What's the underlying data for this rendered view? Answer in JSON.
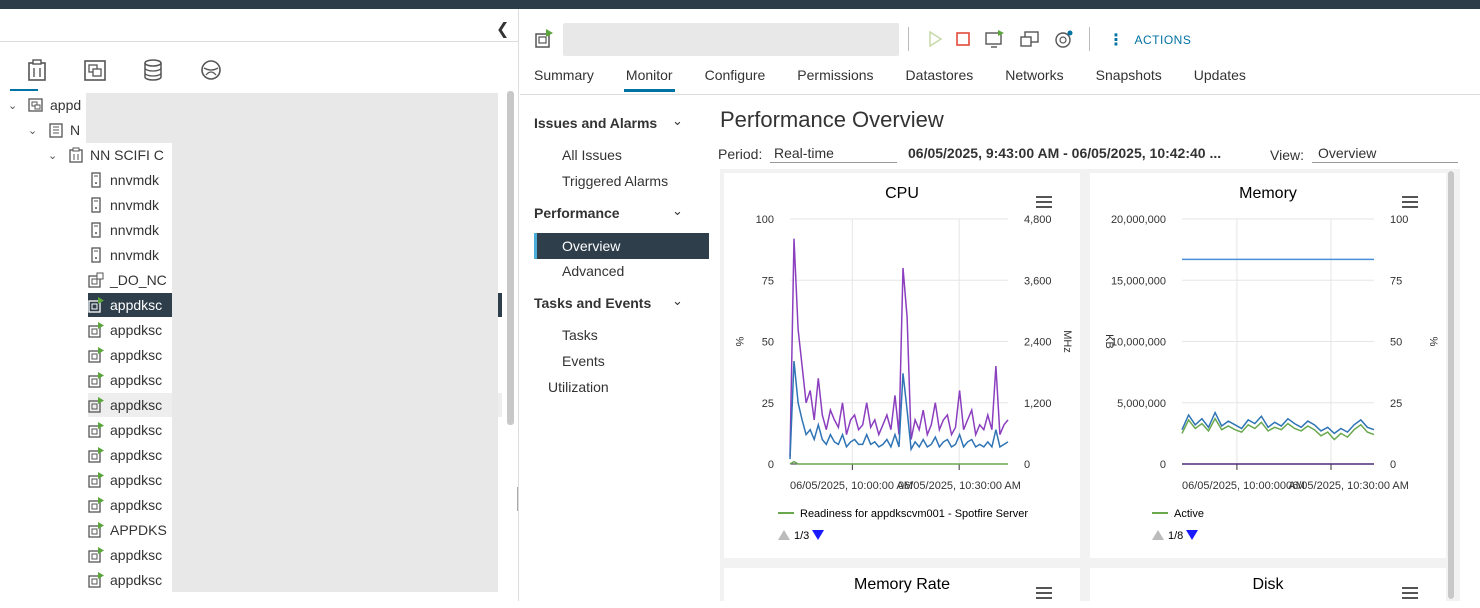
{
  "left_panel": {
    "collapse_icon": "chevron-left-icon",
    "tabs": [
      {
        "name": "hosts-and-clusters",
        "icon": "hosts-clusters-icon",
        "active": true
      },
      {
        "name": "vms-and-templates",
        "icon": "vms-templates-icon",
        "active": false
      },
      {
        "name": "storage",
        "icon": "database-icon",
        "active": false
      },
      {
        "name": "networking",
        "icon": "network-icon",
        "active": false
      }
    ],
    "tree": [
      {
        "label": "appd",
        "level": 0,
        "caret": "▾",
        "icon": "vcenter-icon"
      },
      {
        "label": "N",
        "level": 1,
        "caret": "▾",
        "icon": "datacenter-icon"
      },
      {
        "label": "NN SCIFI C",
        "level": 2,
        "caret": "▾",
        "icon": "cluster-icon"
      },
      {
        "label": "nnvmdk",
        "level": 3,
        "caret": "",
        "icon": "host-icon"
      },
      {
        "label": "nnvmdk",
        "level": 3,
        "caret": "",
        "icon": "host-icon"
      },
      {
        "label": "nnvmdk",
        "level": 3,
        "caret": "",
        "icon": "host-icon"
      },
      {
        "label": "nnvmdk",
        "level": 3,
        "caret": "",
        "icon": "host-icon"
      },
      {
        "label": "_DO_NC",
        "level": 3,
        "caret": "",
        "icon": "vm-off-icon"
      },
      {
        "label": "appdksc",
        "level": 3,
        "caret": "",
        "icon": "vm-on-icon",
        "selected": true
      },
      {
        "label": "appdksc",
        "level": 3,
        "caret": "",
        "icon": "vm-on-icon"
      },
      {
        "label": "appdksc",
        "level": 3,
        "caret": "",
        "icon": "vm-on-icon"
      },
      {
        "label": "appdksc",
        "level": 3,
        "caret": "",
        "icon": "vm-on-icon"
      },
      {
        "label": "appdksc",
        "level": 3,
        "caret": "",
        "icon": "vm-on-icon",
        "hover": true
      },
      {
        "label": "appdksc",
        "level": 3,
        "caret": "",
        "icon": "vm-on-icon"
      },
      {
        "label": "appdksc",
        "level": 3,
        "caret": "",
        "icon": "vm-on-icon"
      },
      {
        "label": "appdksc",
        "level": 3,
        "caret": "",
        "icon": "vm-on-icon"
      },
      {
        "label": "appdksc",
        "level": 3,
        "caret": "",
        "icon": "vm-on-icon"
      },
      {
        "label": "APPDKS",
        "level": 3,
        "caret": "",
        "icon": "vm-on-icon"
      },
      {
        "label": "appdksc",
        "level": 3,
        "caret": "",
        "icon": "vm-on-icon"
      },
      {
        "label": "appdksc",
        "level": 3,
        "caret": "",
        "icon": "vm-on-icon"
      }
    ]
  },
  "toolbar": {
    "object_icon": "vm-on-icon",
    "icons": [
      "power-on-icon",
      "power-off-icon",
      "launch-console-icon",
      "migrate-icon",
      "snapshot-icon"
    ],
    "actions_label": "ACTIONS"
  },
  "tabs": [
    "Summary",
    "Monitor",
    "Configure",
    "Permissions",
    "Datastores",
    "Networks",
    "Snapshots",
    "Updates"
  ],
  "active_tab": "Monitor",
  "nav": {
    "issues_head": "Issues and Alarms",
    "all_issues": "All Issues",
    "triggered_alarms": "Triggered Alarms",
    "performance_head": "Performance",
    "overview": "Overview",
    "advanced": "Advanced",
    "tasks_head": "Tasks and Events",
    "tasks": "Tasks",
    "events": "Events",
    "utilization": "Utilization"
  },
  "content": {
    "title": "Performance Overview",
    "period_label": "Period:",
    "period_value": "Real-time",
    "range": "06/05/2025, 9:43:00 AM - 06/05/2025, 10:42:40 ...",
    "view_label": "View:",
    "view_value": "Overview"
  },
  "chart_data": [
    {
      "type": "line",
      "title": "CPU",
      "ylabel": "%",
      "y2label": "MHz",
      "yticks": [
        "100",
        "75",
        "50",
        "25",
        "0"
      ],
      "y2ticks": [
        "4,800",
        "3,600",
        "2,400",
        "1,200",
        "0"
      ],
      "ylim": [
        0,
        100
      ],
      "xticks": [
        "06/05/2025, 10:00:00 AM",
        "06/05/2025, 10:30:00 AM"
      ],
      "legend": "Readiness for appdkscvm001 - Spotfire Server",
      "legend_page": "1/3",
      "series": [
        {
          "color": "#8b3fbf",
          "values": [
            3,
            92,
            55,
            40,
            25,
            30,
            18,
            35,
            20,
            14,
            22,
            18,
            15,
            25,
            12,
            18,
            20,
            14,
            16,
            25,
            15,
            18,
            12,
            16,
            20,
            14,
            28,
            12,
            80,
            60,
            10,
            18,
            14,
            22,
            12,
            16,
            25,
            14,
            18,
            20,
            12,
            15,
            30,
            14,
            18,
            22,
            12,
            16,
            14,
            20,
            14,
            40,
            12,
            16,
            18
          ]
        },
        {
          "color": "#2f74b5",
          "values": [
            2,
            42,
            25,
            18,
            12,
            14,
            10,
            16,
            10,
            8,
            12,
            9,
            8,
            12,
            7,
            9,
            10,
            8,
            8,
            12,
            8,
            9,
            7,
            8,
            10,
            7,
            12,
            7,
            37,
            22,
            6,
            9,
            7,
            10,
            7,
            8,
            11,
            7,
            9,
            10,
            7,
            8,
            12,
            7,
            9,
            10,
            7,
            8,
            7,
            9,
            7,
            14,
            7,
            8,
            9
          ]
        },
        {
          "color": "#6aa84f",
          "values": [
            0,
            1,
            0,
            0,
            0,
            0,
            0,
            0,
            0,
            0,
            0,
            0,
            0,
            0,
            0,
            0,
            0,
            0,
            0,
            0,
            0,
            0,
            0,
            0,
            0,
            0,
            0,
            0,
            0,
            0,
            0,
            0,
            0,
            0,
            0,
            0,
            0,
            0,
            0,
            0,
            0,
            0,
            0,
            0,
            0,
            0,
            0,
            0,
            0,
            0,
            0,
            0,
            0,
            0,
            0
          ]
        }
      ]
    },
    {
      "type": "line",
      "title": "Memory",
      "ylabel": "KB",
      "y2label": "%",
      "yticks": [
        "20,000,000",
        "15,000,000",
        "10,000,000",
        "5,000,000",
        "0"
      ],
      "y2ticks": [
        "100",
        "75",
        "50",
        "25",
        "0"
      ],
      "ylim": [
        0,
        20000000
      ],
      "xticks": [
        "06/05/2025, 10:00:00 AM",
        "06/05/2025, 10:30:00 AM"
      ],
      "legend": "Active",
      "legend_page": "1/8",
      "series": [
        {
          "color": "#4a90d9",
          "values": [
            16700000,
            16700000,
            16700000,
            16700000,
            16700000,
            16700000,
            16700000,
            16700000,
            16700000,
            16700000,
            16700000,
            16700000,
            16700000,
            16700000,
            16700000,
            16700000,
            16700000,
            16700000,
            16700000,
            16700000,
            16700000,
            16700000,
            16700000,
            16700000,
            16700000,
            16700000,
            16700000,
            16700000,
            16700000,
            16700000
          ]
        },
        {
          "color": "#2f74b5",
          "values": [
            2800000,
            4000000,
            3200000,
            3700000,
            3000000,
            4200000,
            3100000,
            3500000,
            3200000,
            2900000,
            3600000,
            3300000,
            3900000,
            3000000,
            3400000,
            3100000,
            3700000,
            3300000,
            3000000,
            3500000,
            3200000,
            2700000,
            3000000,
            2500000,
            2900000,
            2600000,
            3200000,
            3600000,
            3000000,
            2800000
          ]
        },
        {
          "color": "#6aa84f",
          "values": [
            2500000,
            3600000,
            2900000,
            3300000,
            2700000,
            3700000,
            2800000,
            3100000,
            2800000,
            2600000,
            3200000,
            2900000,
            3400000,
            2700000,
            3000000,
            2800000,
            3300000,
            2900000,
            2700000,
            3100000,
            2800000,
            2300000,
            2600000,
            2000000,
            2500000,
            2200000,
            2800000,
            3200000,
            2600000,
            2400000
          ]
        },
        {
          "color": "#4b2c7a",
          "values": [
            0,
            0,
            0,
            0,
            0,
            0,
            0,
            0,
            0,
            0,
            0,
            0,
            0,
            0,
            0,
            0,
            0,
            0,
            0,
            0,
            0,
            0,
            0,
            0,
            0,
            0,
            0,
            0,
            0,
            0
          ]
        }
      ]
    }
  ],
  "lower_cards": {
    "memory_rate": "Memory Rate",
    "disk": "Disk"
  }
}
